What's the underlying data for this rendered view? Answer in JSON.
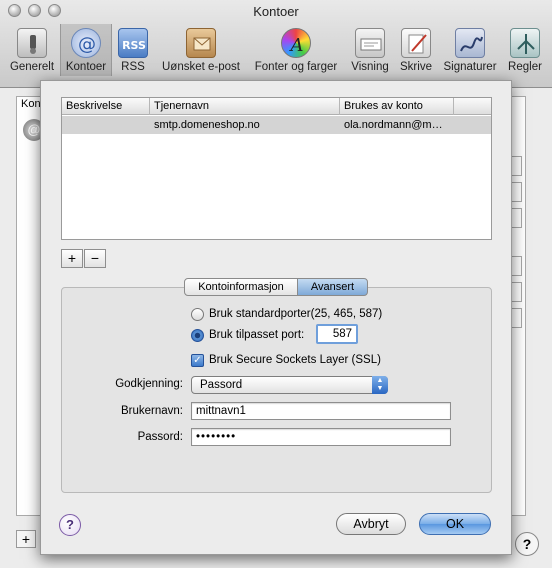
{
  "window": {
    "title": "Kontoer"
  },
  "toolbar": {
    "items": [
      {
        "label": "Generelt",
        "icon": "switch-icon"
      },
      {
        "label": "Kontoer",
        "icon": "at-sign-icon"
      },
      {
        "label": "RSS",
        "icon": "rss-icon"
      },
      {
        "label": "Uønsket e-post",
        "icon": "junk-mail-icon"
      },
      {
        "label": "Fonter og farger",
        "icon": "fonts-colors-icon"
      },
      {
        "label": "Visning",
        "icon": "viewing-icon"
      },
      {
        "label": "Skrive",
        "icon": "compose-icon"
      },
      {
        "label": "Signaturer",
        "icon": "signature-icon"
      },
      {
        "label": "Regler",
        "icon": "rules-icon"
      }
    ]
  },
  "background": {
    "list_header": "Kon",
    "plus": "+",
    "help": "?"
  },
  "smtp_table": {
    "columns": [
      "Beskrivelse",
      "Tjenernavn",
      "Brukes av konto"
    ],
    "rows": [
      {
        "description": "",
        "server": "smtp.domeneshop.no",
        "used_by": "ola.nordmann@m…"
      }
    ]
  },
  "list_buttons": {
    "add": "+",
    "remove": "−"
  },
  "tabs": {
    "account_info": "Kontoinformasjon",
    "advanced": "Avansert",
    "selected": "Avansert"
  },
  "advanced": {
    "default_ports_label": "Bruk standardporter(25, 465, 587)",
    "custom_port_label": "Bruk tilpasset port:",
    "custom_port_value": "587",
    "ssl_label": "Bruk Secure Sockets Layer (SSL)",
    "auth_label": "Godkjenning:",
    "auth_value": "Passord",
    "username_label": "Brukernavn:",
    "username_value": "mittnavn1",
    "password_label": "Passord:",
    "password_value": "••••••••"
  },
  "buttons": {
    "cancel": "Avbryt",
    "ok": "OK",
    "help": "?"
  }
}
